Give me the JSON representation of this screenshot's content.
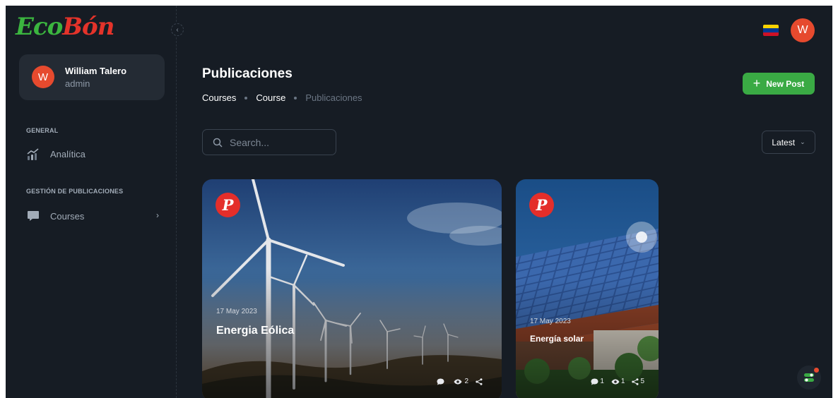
{
  "brand": {
    "logo_eco": "Eco",
    "logo_bon": "Bón",
    "flag": [
      "#f8d200",
      "#003893",
      "#ce1126"
    ]
  },
  "user": {
    "name": "William Talero",
    "role": "admin",
    "initial": "W"
  },
  "sidebar": {
    "sections": [
      {
        "title": "GENERAL",
        "items": [
          {
            "label": "Analítica",
            "icon": "analytics-icon"
          }
        ]
      },
      {
        "title": "GESTIÓN DE PUBLICACIONES",
        "items": [
          {
            "label": "Courses",
            "icon": "chat-icon",
            "has_submenu": true
          }
        ]
      }
    ]
  },
  "header": {
    "avatar_initial": "W"
  },
  "page": {
    "title": "Publicaciones",
    "breadcrumb": [
      "Courses",
      "Course",
      "Publicaciones"
    ],
    "new_post_label": "New Post",
    "search_placeholder": "Search...",
    "sort_value": "Latest"
  },
  "posts": [
    {
      "date": "17 May 2023",
      "title": "Energia Eólica",
      "badge": "P",
      "comments": "",
      "views": "2",
      "shares": ""
    },
    {
      "date": "17 May 2023",
      "title": "Energía solar",
      "badge": "P",
      "comments": "1",
      "views": "1",
      "shares": "5"
    }
  ],
  "colors": {
    "accent_green": "#3aaa44",
    "avatar_red": "#e64a2e",
    "background": "#161c24"
  }
}
